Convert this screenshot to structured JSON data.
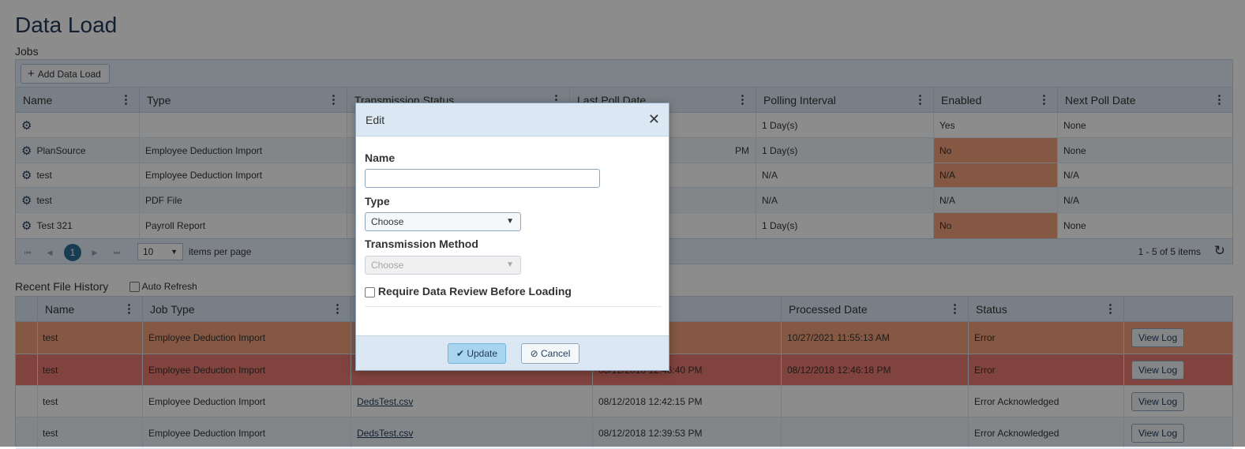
{
  "page": {
    "title": "Data Load"
  },
  "jobs": {
    "section_label": "Jobs",
    "add_button": "Add Data Load",
    "columns": [
      "Name",
      "Type",
      "Transmission Status",
      "Last Poll Date",
      "Polling Interval",
      "Enabled",
      "Next Poll Date"
    ],
    "rows": [
      {
        "name": "",
        "type": "",
        "status": "",
        "last_poll": "",
        "interval": "1 Day(s)",
        "enabled": "Yes",
        "next_poll": "None"
      },
      {
        "name": "PlanSource",
        "type": "Employee Deduction Import",
        "status": "",
        "last_poll": "PM",
        "interval": "1 Day(s)",
        "enabled": "No",
        "next_poll": "None"
      },
      {
        "name": "test",
        "type": "Employee Deduction Import",
        "status": "",
        "last_poll": "",
        "interval": "N/A",
        "enabled": "N/A",
        "next_poll": "N/A"
      },
      {
        "name": "test",
        "type": "PDF File",
        "status": "",
        "last_poll": "",
        "interval": "N/A",
        "enabled": "N/A",
        "next_poll": "N/A"
      },
      {
        "name": "Test 321",
        "type": "Payroll Report",
        "status": "",
        "last_poll": "",
        "interval": "1 Day(s)",
        "enabled": "No",
        "next_poll": "None"
      }
    ],
    "pager": {
      "current_page": "1",
      "page_size": "10",
      "per_page_label": "items per page",
      "info": "1 - 5 of 5 items"
    }
  },
  "history": {
    "section_label": "Recent File History",
    "auto_refresh_label": "Auto Refresh",
    "columns": [
      "Name",
      "Job Type",
      "",
      "mp",
      "Processed Date",
      "Status",
      ""
    ],
    "rows": [
      {
        "name": "test",
        "job_type": "Employee Deduction Import",
        "file": "",
        "timestamp": "",
        "processed": "10/27/2021 11:55:13 AM",
        "status": "Error",
        "action": "View Log"
      },
      {
        "name": "test",
        "job_type": "Employee Deduction Import",
        "file": "",
        "timestamp": "08/12/2018 12:46:40 PM",
        "processed": "08/12/2018 12:46:18 PM",
        "status": "Error",
        "action": "View Log"
      },
      {
        "name": "test",
        "job_type": "Employee Deduction Import",
        "file": "DedsTest.csv",
        "timestamp": "08/12/2018 12:42:15 PM",
        "processed": "",
        "status": "Error Acknowledged",
        "action": "View Log"
      },
      {
        "name": "test",
        "job_type": "Employee Deduction Import",
        "file": "DedsTest.csv",
        "timestamp": "08/12/2018 12:39:53 PM",
        "processed": "",
        "status": "Error Acknowledged",
        "action": "View Log"
      }
    ]
  },
  "modal": {
    "title": "Edit",
    "name_label": "Name",
    "name_value": "",
    "type_label": "Type",
    "type_value": "Choose",
    "method_label": "Transmission Method",
    "method_value": "Choose",
    "review_label": "Require Data Review Before Loading",
    "update_button": "Update",
    "cancel_button": "Cancel"
  },
  "icons": {
    "gear": "gear-icon",
    "kebab": "kebab-menu-icon",
    "close": "close-icon",
    "check": "check-icon",
    "cancel": "cancel-icon",
    "refresh": "refresh-icon",
    "plus": "plus-icon"
  },
  "colors": {
    "row_orange": "#f2a07b",
    "row_red": "#ec7b6f",
    "header_bg": "#dbe8f4",
    "primary_button": "#a7d4ef"
  }
}
